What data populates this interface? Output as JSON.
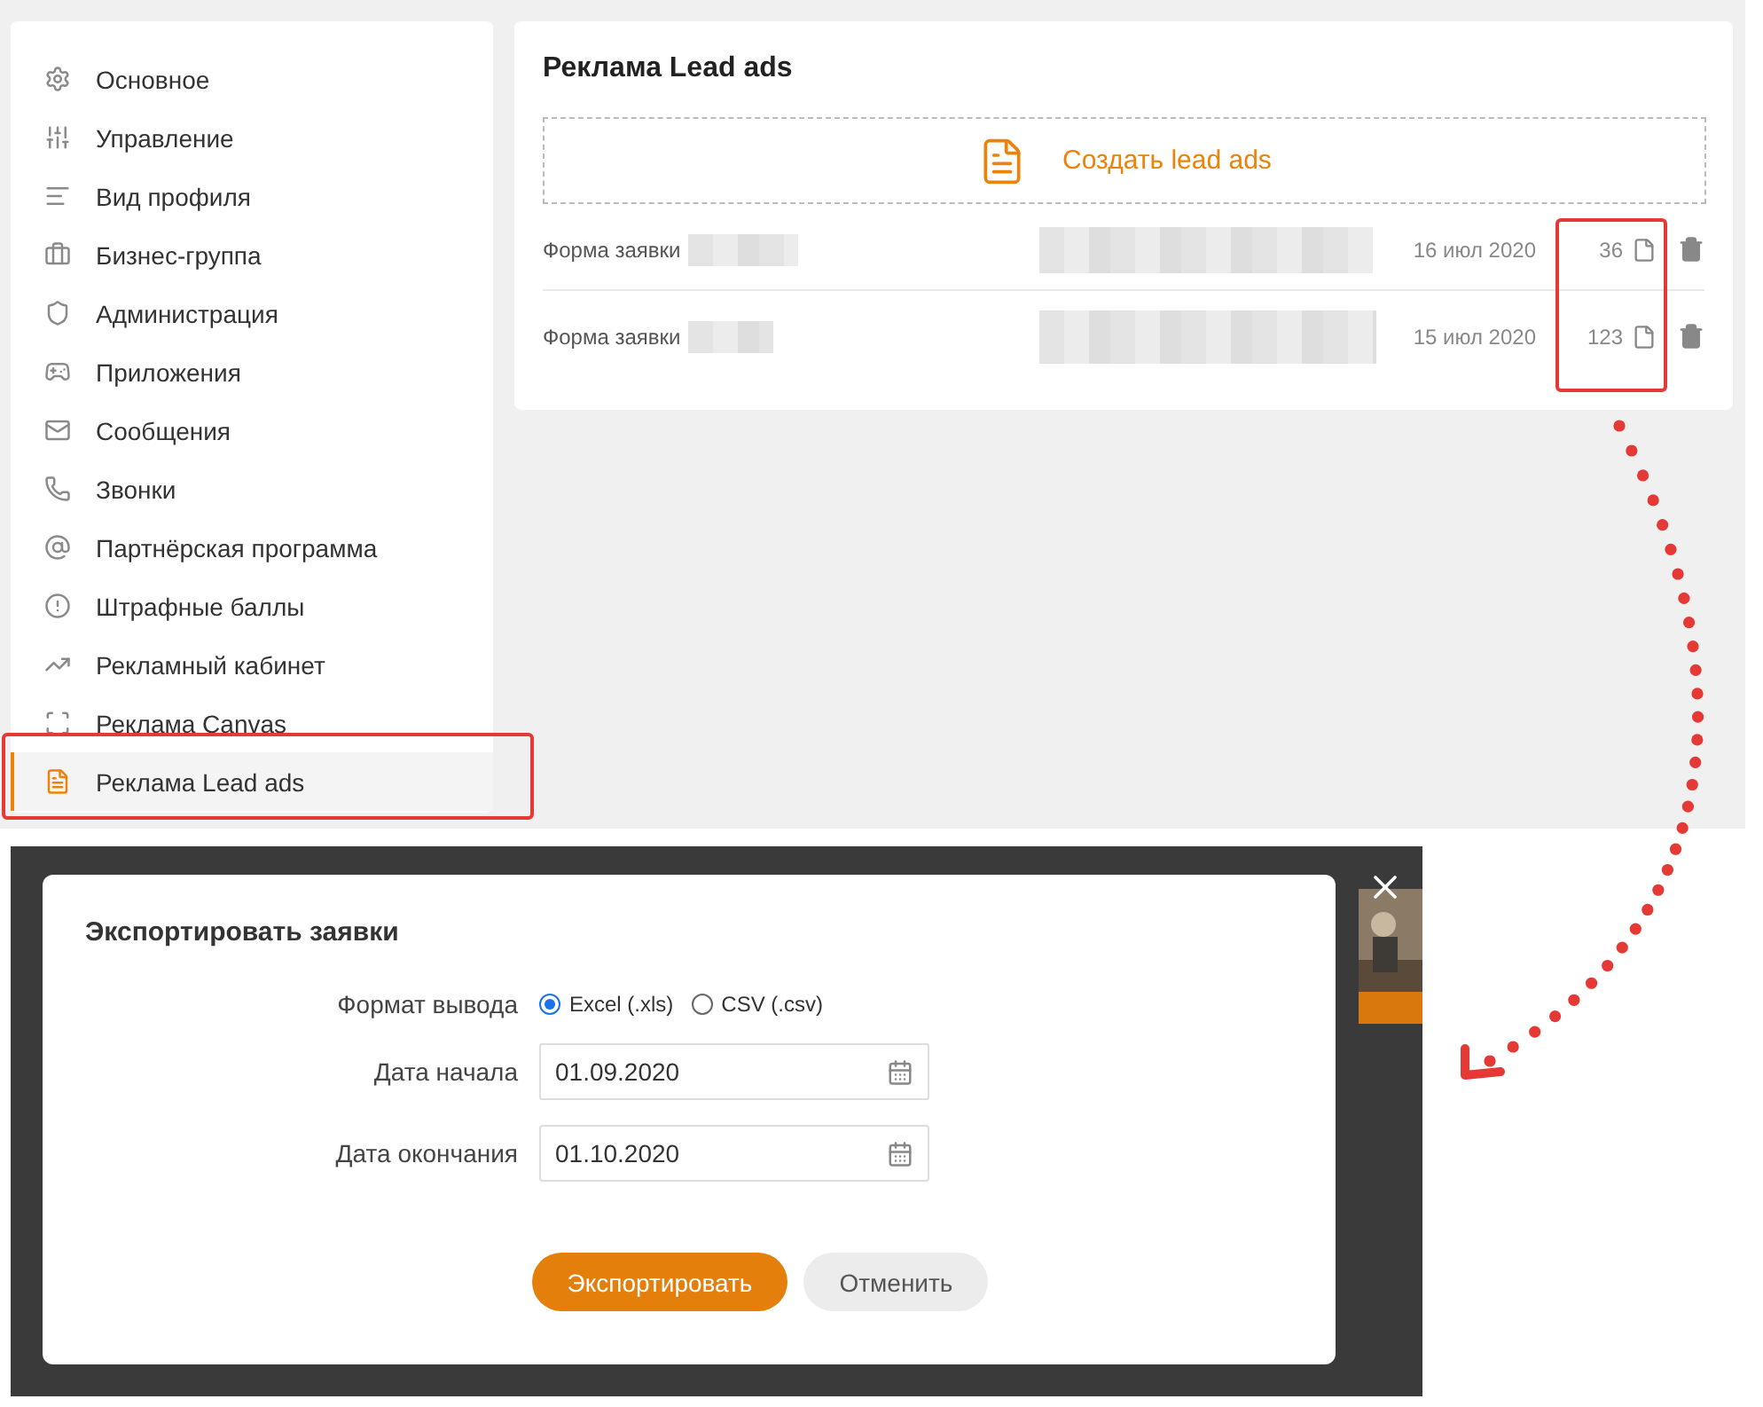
{
  "sidebar": {
    "items": [
      {
        "label": "Основное",
        "selected": false
      },
      {
        "label": "Управление",
        "selected": false
      },
      {
        "label": "Вид профиля",
        "selected": false
      },
      {
        "label": "Бизнес-группа",
        "selected": false
      },
      {
        "label": "Администрация",
        "selected": false
      },
      {
        "label": "Приложения",
        "selected": false
      },
      {
        "label": "Сообщения",
        "selected": false
      },
      {
        "label": "Звонки",
        "selected": false
      },
      {
        "label": "Партнёрская программа",
        "selected": false
      },
      {
        "label": "Штрафные баллы",
        "selected": false
      },
      {
        "label": "Рекламный кабинет",
        "selected": false
      },
      {
        "label": "Реклама Canvas",
        "selected": false
      },
      {
        "label": "Реклама Lead ads",
        "selected": true
      }
    ]
  },
  "main": {
    "title": "Реклама Lead ads",
    "create_button": "Создать lead ads",
    "rows": [
      {
        "name": "Форма заявки",
        "date": "16 июл 2020",
        "count": "36"
      },
      {
        "name": "Форма заявки",
        "date": "15 июл 2020",
        "count": "123"
      }
    ]
  },
  "dialog": {
    "title": "Экспортировать заявки",
    "format": {
      "label": "Формат вывода",
      "options": [
        {
          "label": "Excel (.xls)",
          "selected": true
        },
        {
          "label": "CSV (.csv)",
          "selected": false
        }
      ]
    },
    "start": {
      "label": "Дата начала",
      "value": "01.09.2020"
    },
    "end": {
      "label": "Дата окончания",
      "value": "01.10.2020"
    },
    "buttons": [
      {
        "label": "Экспортировать",
        "kind": "primary"
      },
      {
        "label": "Отменить",
        "kind": "secondary"
      }
    ]
  }
}
